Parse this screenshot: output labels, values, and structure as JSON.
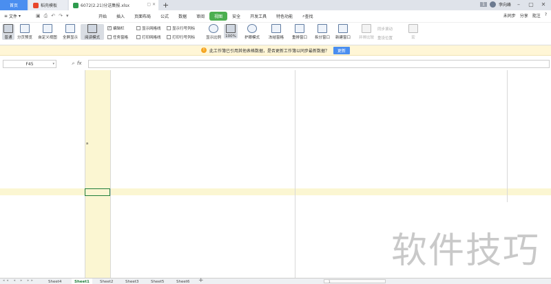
{
  "tabs": {
    "home": "首页",
    "template": "稻壳模板",
    "doc": "6072(2.21)分送集报.xlsx",
    "doc_actions": "▢ ✕"
  },
  "topright": {
    "count": "1",
    "user": "李向峰"
  },
  "menu": {
    "file": "文件",
    "items": [
      "开始",
      "插入",
      "页面布局",
      "公式",
      "数据",
      "审阅",
      "视图",
      "安全",
      "开发工具",
      "特色功能"
    ],
    "active": "视图",
    "search": "查找",
    "right": [
      "未同步",
      "分享",
      "批注",
      "?"
    ]
  },
  "ribbon": {
    "buttons": [
      {
        "label": "普通",
        "selected": true
      },
      {
        "label": "分页预览"
      },
      {
        "label": "自定义视图"
      },
      {
        "label": "全屏显示"
      },
      {
        "label": "阅读模式"
      },
      {
        "label": "显示比例"
      },
      {
        "label": "100%",
        "selected": true
      },
      {
        "label": "护眼模式"
      },
      {
        "label": "冻结窗格"
      },
      {
        "label": "重排窗口"
      },
      {
        "label": "拆分窗口"
      },
      {
        "label": "新建窗口"
      },
      {
        "label": "并排比较",
        "dim": true
      },
      {
        "label": "宏",
        "dim": true
      }
    ],
    "checks": [
      {
        "label": "编辑栏",
        "checked": true
      },
      {
        "label": "任务窗格",
        "checked": false
      },
      {
        "label": "显示网格线",
        "checked": false
      },
      {
        "label": "打印网格线",
        "checked": false
      },
      {
        "label": "显示行号列标",
        "checked": false
      },
      {
        "label": "打印行号列标",
        "checked": false
      }
    ],
    "sync": [
      "同步滚动",
      "重设位置"
    ]
  },
  "notice": {
    "text": "此工作簿已引用其他表格数据，是否更新工作簿以同步最新数据？",
    "button": "更新"
  },
  "formula": {
    "cell": "F45",
    "fx": "fx"
  },
  "sheet": {
    "cell_mark": "a",
    "watermark": "软件技巧"
  },
  "sheets": [
    "Sheet4",
    "Sheet1",
    "Sheet2",
    "Sheet3",
    "Sheet5",
    "Sheet6"
  ],
  "active_sheet": "Sheet1",
  "hscroll": "1"
}
